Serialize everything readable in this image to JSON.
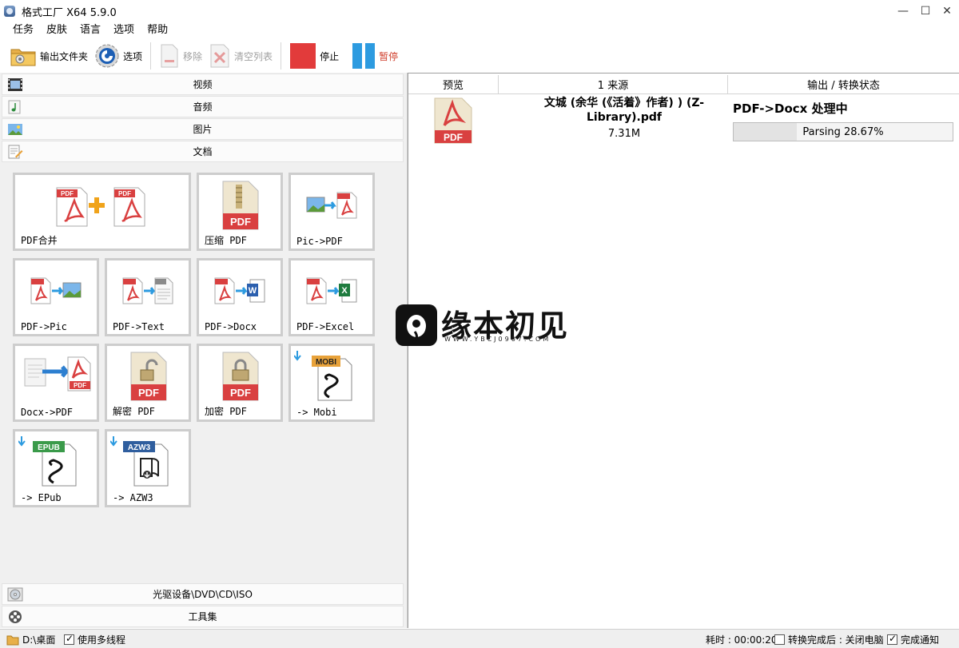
{
  "window": {
    "title": "格式工厂 X64 5.9.0"
  },
  "menu": [
    "任务",
    "皮肤",
    "语言",
    "选项",
    "帮助"
  ],
  "toolbar": {
    "output_folder": "输出文件夹",
    "options": "选项",
    "remove": "移除",
    "clear_list": "清空列表",
    "stop": "停止",
    "pause": "暂停"
  },
  "categories": {
    "video": "视频",
    "audio": "音频",
    "image": "图片",
    "document": "文档",
    "optical": "光驱设备\\DVD\\CD\\ISO",
    "tools": "工具集"
  },
  "tiles": [
    {
      "label": "PDF合并",
      "icon": "pdf-merge-icon"
    },
    {
      "label": "压缩 PDF",
      "icon": "pdf-compress-icon"
    },
    {
      "label": "Pic->PDF",
      "icon": "pic-to-pdf-icon"
    },
    {
      "label": "PDF->Pic",
      "icon": "pdf-to-pic-icon"
    },
    {
      "label": "PDF->Text",
      "icon": "pdf-to-text-icon"
    },
    {
      "label": "PDF->Docx",
      "icon": "pdf-to-docx-icon"
    },
    {
      "label": "PDF->Excel",
      "icon": "pdf-to-excel-icon"
    },
    {
      "label": "Docx->PDF",
      "icon": "docx-to-pdf-icon"
    },
    {
      "label": "解密 PDF",
      "icon": "pdf-decrypt-icon"
    },
    {
      "label": "加密 PDF",
      "icon": "pdf-encrypt-icon"
    },
    {
      "label": "-> Mobi",
      "icon": "mobi-icon"
    },
    {
      "label": "-> EPub",
      "icon": "epub-icon"
    },
    {
      "label": "-> AZW3",
      "icon": "azw3-icon"
    }
  ],
  "task_list": {
    "columns": [
      "预览",
      "1 来源",
      "输出 / 转换状态"
    ],
    "rows": [
      {
        "file_name": "文城 (余华 (《活着》作者) ) (Z-Library).pdf",
        "file_size": "7.31M",
        "status": "PDF->Docx 处理中",
        "progress_text": "Parsing 28.67%",
        "progress_percent": 28.67,
        "thumb_label": "PDF"
      }
    ]
  },
  "watermark": {
    "name": "缘本初见",
    "url": "WWW.YBCJ0907.COM"
  },
  "statusbar": {
    "path": "D:\\桌面",
    "multithread_label": "使用多线程",
    "multithread_checked": true,
    "elapsed": "耗时 : 00:00:20",
    "after_label": "转换完成后 : 关闭电脑",
    "after_checked": false,
    "notify_label": "完成通知",
    "notify_checked": true
  },
  "colors": {
    "pdf_red": "#d94040",
    "stop_red": "#e23b3b",
    "pause_blue": "#2d9be0",
    "tile_border": "#cdcdcd"
  }
}
